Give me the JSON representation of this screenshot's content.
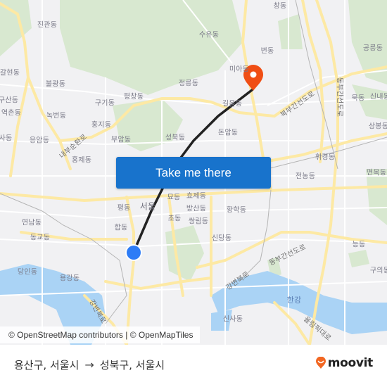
{
  "map": {
    "labels": [
      {
        "text": "진관동"
      },
      {
        "text": "수유동"
      },
      {
        "text": "창동"
      },
      {
        "text": "공릉동"
      },
      {
        "text": "번동"
      },
      {
        "text": "미아동"
      },
      {
        "text": "갈현동"
      },
      {
        "text": "불광동"
      },
      {
        "text": "정릉동"
      },
      {
        "text": "평창동"
      },
      {
        "text": "구기동"
      },
      {
        "text": "구산동"
      },
      {
        "text": "역촌동"
      },
      {
        "text": "녹번동"
      },
      {
        "text": "홍지동"
      },
      {
        "text": "길음동"
      },
      {
        "text": "묵동"
      },
      {
        "text": "신내동"
      },
      {
        "text": "돈암동"
      },
      {
        "text": "사동"
      },
      {
        "text": "응암동"
      },
      {
        "text": "부암동"
      },
      {
        "text": "성북동"
      },
      {
        "text": "홍제동"
      },
      {
        "text": "상봉동"
      },
      {
        "text": "휘경동"
      },
      {
        "text": "전농동"
      },
      {
        "text": "면목동"
      },
      {
        "text": "묘동"
      },
      {
        "text": "효제동"
      },
      {
        "text": "평동"
      },
      {
        "text": "서울"
      },
      {
        "text": "방산동"
      },
      {
        "text": "황학동"
      },
      {
        "text": "연남동"
      },
      {
        "text": "초동"
      },
      {
        "text": "쌍림동"
      },
      {
        "text": "합동"
      },
      {
        "text": "신당동"
      },
      {
        "text": "동교동"
      },
      {
        "text": "능동"
      },
      {
        "text": "당인동"
      },
      {
        "text": "용강동"
      },
      {
        "text": "구의동"
      },
      {
        "text": "신사동"
      },
      {
        "text": "한강"
      },
      {
        "text": "강변북로"
      },
      {
        "text": "동부간선도로"
      },
      {
        "text": "북부간선도로"
      },
      {
        "text": "내부순환로"
      },
      {
        "text": "올림픽대로"
      },
      {
        "text": "동부간선도로"
      },
      {
        "text": "강변북로"
      }
    ],
    "origin_marker": {
      "name": "origin",
      "color": "#2d7cf6"
    },
    "destination_marker": {
      "name": "destination",
      "color": "#f04e14"
    },
    "route_color": "#222222"
  },
  "cta": {
    "label": "Take me there"
  },
  "attribution": {
    "text": "© OpenStreetMap contributors | © OpenMapTiles"
  },
  "footer": {
    "origin": "용산구, 서울시",
    "arrow": "→",
    "destination": "성북구, 서울시",
    "brand": "moovit",
    "brand_color": "#f26722"
  }
}
